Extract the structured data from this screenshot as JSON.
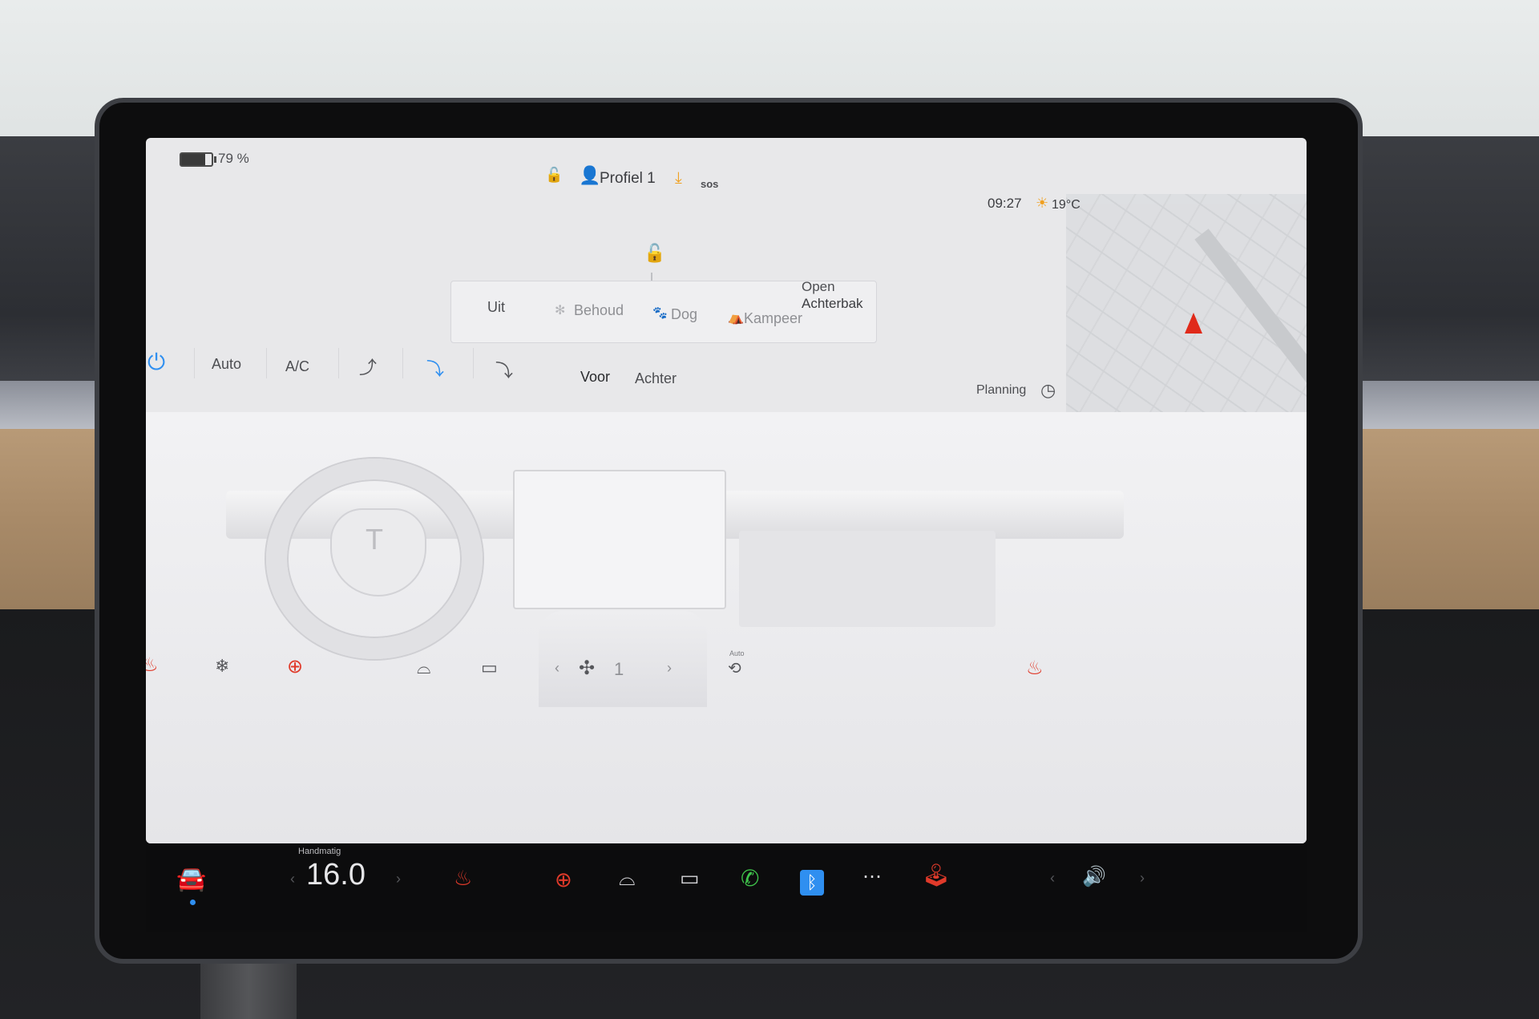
{
  "status_bar": {
    "battery_percent": "79 %",
    "battery_level": 0.79,
    "profile_name": "Profiel 1",
    "sos_label": "sos",
    "time": "09:27",
    "temperature": "19°C"
  },
  "vehicle": {
    "trunk_label_1": "Open",
    "trunk_label_2": "Achterbak"
  },
  "modes": {
    "items": [
      {
        "label": "Uit"
      },
      {
        "label": "Behoud"
      },
      {
        "label": "Dog"
      },
      {
        "label": "Kampeer"
      }
    ]
  },
  "climate": {
    "auto_label": "Auto",
    "ac_label": "A/C",
    "front_label": "Voor",
    "rear_label": "Achter",
    "planning_label": "Planning",
    "fan_speed": "1",
    "recirc_auto_label": "Auto"
  },
  "taskbar": {
    "mode_label": "Handmatig",
    "temperature_setting": "16.0"
  },
  "colors": {
    "accent_blue": "#2f8ff0",
    "phone_green": "#3ec24a",
    "heat_red": "#e03a2a",
    "nav_red": "#e02a1a",
    "download_orange": "#f0a020"
  },
  "icons": {
    "battery": "battery-icon",
    "lock": "lock-icon",
    "profile": "person-icon",
    "download": "download-icon",
    "sos": "sos-icon",
    "sun": "sun-icon",
    "nav": "navigation-arrow-icon",
    "power": "power-icon",
    "car": "car-icon",
    "seat_heat": "seat-heater-icon",
    "wheel_heat": "steering-wheel-heater-icon",
    "defrost_front": "front-defrost-icon",
    "defrost_rear": "rear-defrost-icon",
    "phone": "phone-icon",
    "bluetooth": "bluetooth-icon",
    "more": "more-icon",
    "joystick": "joystick-icon",
    "volume": "volume-icon",
    "fan": "fan-icon",
    "clock": "clock-icon"
  }
}
